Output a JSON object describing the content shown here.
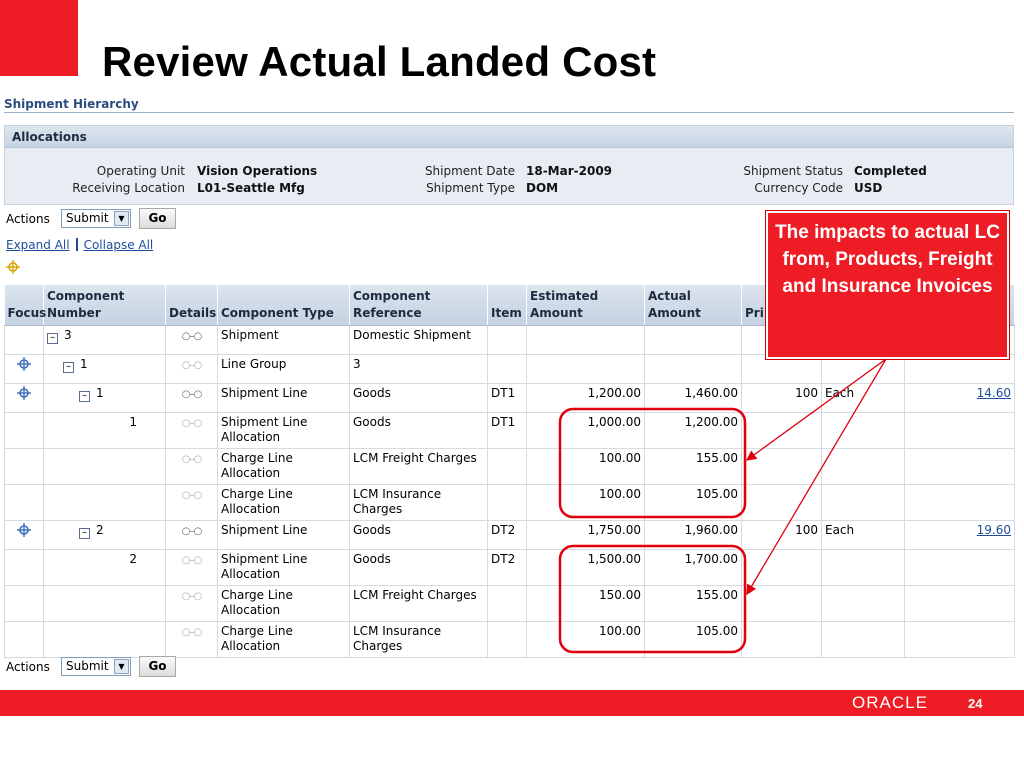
{
  "slide": {
    "title": "Review Actual Landed Cost",
    "page_number": "24",
    "oracle_logo": "ORACLE"
  },
  "breadcrumb": "Shipment Hierarchy",
  "allocations": {
    "header": "Allocations",
    "operating_unit_label": "Operating Unit",
    "operating_unit": "Vision Operations",
    "receiving_location_label": "Receiving Location",
    "receiving_location": "L01-Seattle Mfg",
    "shipment_date_label": "Shipment Date",
    "shipment_date": "18-Mar-2009",
    "shipment_type_label": "Shipment Type",
    "shipment_type": "DOM",
    "shipment_status_label": "Shipment Status",
    "shipment_status": "Completed",
    "currency_code_label": "Currency Code",
    "currency_code": "USD"
  },
  "actions": {
    "label": "Actions",
    "selected": "Submit",
    "go": "Go"
  },
  "tree_links": {
    "expand_all": "Expand All",
    "collapse_all": "Collapse All"
  },
  "columns": {
    "focus": "Focus",
    "component_number": "Component Number",
    "details": "Details",
    "component_type": "Component Type",
    "component_reference": "Component Reference",
    "item": "Item",
    "estimated_amount": "Estimated Amount",
    "actual_amount": "Actual Amount",
    "primary_qty": "Pri Qty"
  },
  "rows": [
    {
      "num": "3",
      "type": "Shipment",
      "ref": "Domestic Shipment",
      "item": "",
      "est": "",
      "act": "",
      "qty": "",
      "uom": "",
      "unit": ""
    },
    {
      "num": "1",
      "type": "Line Group",
      "ref": "3",
      "item": "",
      "est": "",
      "act": "",
      "qty": "",
      "uom": "",
      "unit": ""
    },
    {
      "num": "1",
      "type": "Shipment Line",
      "ref": "Goods",
      "item": "DT1",
      "est": "1,200.00",
      "act": "1,460.00",
      "qty": "100",
      "uom": "Each",
      "unit": "14.60"
    },
    {
      "num": "1",
      "type": "Shipment Line Allocation",
      "ref": "Goods",
      "item": "DT1",
      "est": "1,000.00",
      "act": "1,200.00",
      "qty": "",
      "uom": "",
      "unit": ""
    },
    {
      "num": "",
      "type": "Charge Line Allocation",
      "ref": "LCM Freight Charges",
      "item": "",
      "est": "100.00",
      "act": "155.00",
      "qty": "",
      "uom": "",
      "unit": ""
    },
    {
      "num": "",
      "type": "Charge Line Allocation",
      "ref": "LCM Insurance Charges",
      "item": "",
      "est": "100.00",
      "act": "105.00",
      "qty": "",
      "uom": "",
      "unit": ""
    },
    {
      "num": "2",
      "type": "Shipment Line",
      "ref": "Goods",
      "item": "DT2",
      "est": "1,750.00",
      "act": "1,960.00",
      "qty": "100",
      "uom": "Each",
      "unit": "19.60"
    },
    {
      "num": "2",
      "type": "Shipment Line Allocation",
      "ref": "Goods",
      "item": "DT2",
      "est": "1,500.00",
      "act": "1,700.00",
      "qty": "",
      "uom": "",
      "unit": ""
    },
    {
      "num": "",
      "type": "Charge Line Allocation",
      "ref": "LCM Freight Charges",
      "item": "",
      "est": "150.00",
      "act": "155.00",
      "qty": "",
      "uom": "",
      "unit": ""
    },
    {
      "num": "",
      "type": "Charge Line Allocation",
      "ref": "LCM Insurance Charges",
      "item": "",
      "est": "100.00",
      "act": "105.00",
      "qty": "",
      "uom": "",
      "unit": ""
    }
  ],
  "callout": "The impacts to actual LC from, Products, Freight and Insurance Invoices",
  "colors": {
    "brand_red": "#ee1c25",
    "link_blue": "#1f4e9c",
    "header_blue": "#c5d2e1"
  },
  "icons": {
    "focus": "crosshair-icon",
    "details": "glasses-icon",
    "tree_toggle": "minus-box-icon"
  }
}
